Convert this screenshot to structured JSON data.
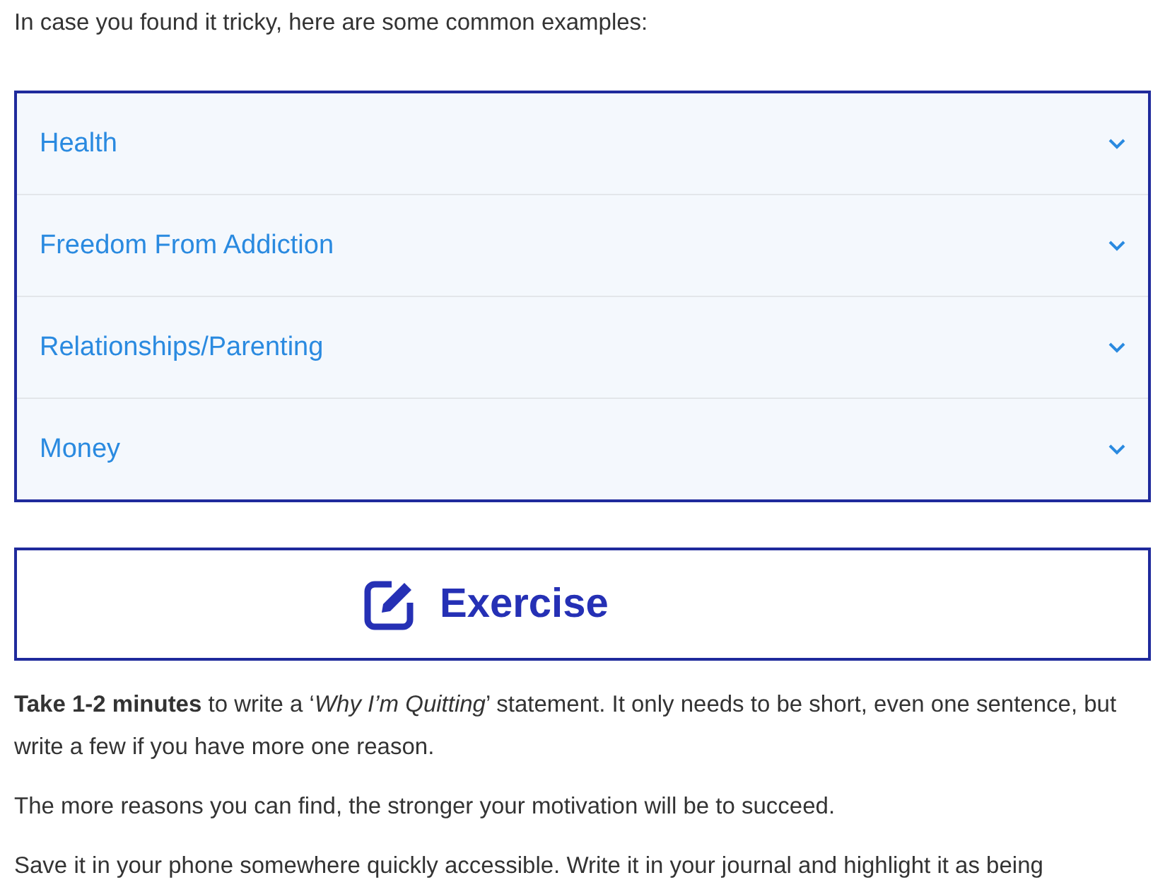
{
  "intro": "In case you found it tricky, here are some common examples:",
  "accordion": [
    {
      "title": "Health",
      "expanded": false
    },
    {
      "title": "Freedom From Addiction",
      "expanded": false
    },
    {
      "title": "Relationships/Parenting",
      "expanded": false
    },
    {
      "title": "Money",
      "expanded": false
    }
  ],
  "exercise": {
    "title": "Exercise"
  },
  "paragraphs": [
    "**Take 1-2 minutes** to write a ‘*Why I’m Quitting*’ statement. It only needs to be short, even one sentence, but write a few if you have more one reason.",
    "The more reasons you can find, the stronger your motivation will be to succeed.",
    "Save it in your phone somewhere quickly accessible. Write it in your journal and highlight it as being"
  ]
}
